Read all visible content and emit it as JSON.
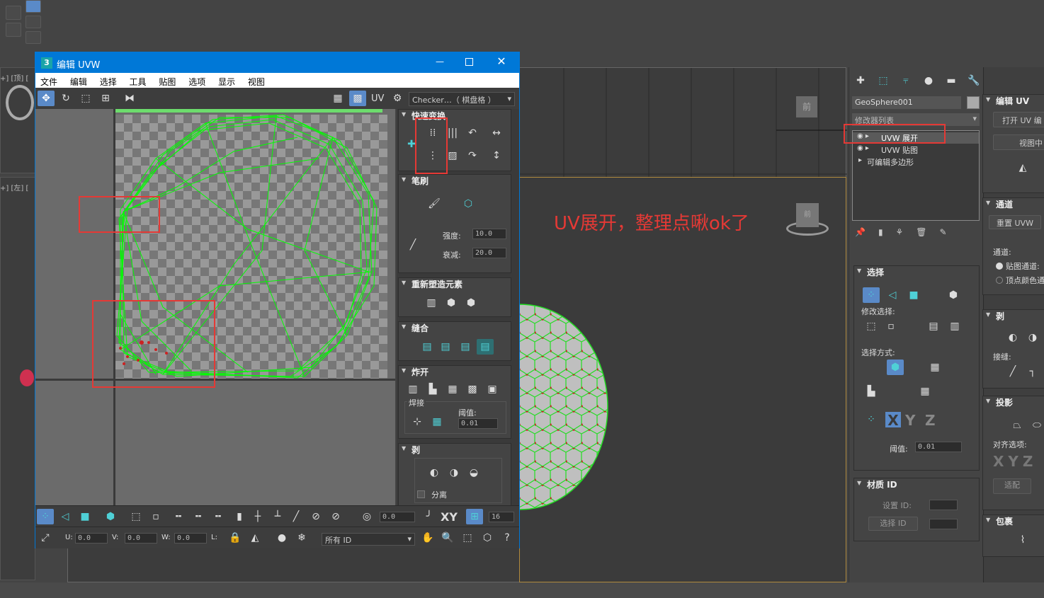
{
  "uvw_window": {
    "title": "编辑 UVW",
    "title_icon": "3",
    "menu": [
      "文件",
      "编辑",
      "选择",
      "工具",
      "贴图",
      "选项",
      "显示",
      "视图"
    ],
    "uv_label": "UV",
    "checker_label": "Checker…（ 棋盘格 ）"
  },
  "rollouts": {
    "quick": "快速变换",
    "brush": "笔刷",
    "strength_label": "强度:",
    "strength_value": "10.0",
    "falloff_label": "衰减:",
    "falloff_value": "20.0",
    "reshape": "重新塑造元素",
    "stitch": "缝合",
    "explode": "炸开",
    "weld": "焊接",
    "threshold_label": "阈值:",
    "threshold_value": "0.01",
    "peel": "剥",
    "detach": "分离"
  },
  "bottom_bar": {
    "angle_value": "0.0",
    "xy_label": "XY",
    "size_value": "16",
    "u_label": "U:",
    "u_value": "0.0",
    "v_label": "V:",
    "v_value": "0.0",
    "w_label": "W:",
    "w_value": "0.0",
    "l_label": "L:",
    "id_select": "所有 ID"
  },
  "viewport": {
    "annotation": "UV展开，整理点啾ok了",
    "annotation_color": "#e53935",
    "cube_label": "前",
    "left_labels": [
      "+] [顶] [",
      "+] [左] ["
    ]
  },
  "command_panel": {
    "object_name": "GeoSphere001",
    "modifier_list": "修改器列表",
    "stack": [
      "UVW 展开",
      "UVW 贴图",
      "可编辑多边形"
    ],
    "selection_rollout": "选择",
    "modify_selection": "修改选择:",
    "select_by": "选择方式:",
    "threshold_label": "阈值:",
    "threshold_value": "0.01",
    "material_id_rollout": "材质 ID",
    "set_id": "设置 ID:",
    "select_id": "选择 ID"
  },
  "right_panel": {
    "edit_uv": "编辑 UV",
    "open_uv": "打开 UV 编",
    "view": "视图中",
    "channel": "通道",
    "reset_uvw": "重置 UVW",
    "channel_label": "通道:",
    "map_channel": "贴图通道:",
    "vertex_color": "顶点颜色通",
    "peel": "剥",
    "seams": "接缝:",
    "projection": "投影",
    "align_options": "对齐选项:",
    "fit": "适配",
    "wrap": "包裹"
  },
  "colors": {
    "accent": "#4fd0d6",
    "uv_lines": "#00ff00",
    "highlight": "#e53935",
    "title_bar": "#0078d7"
  }
}
